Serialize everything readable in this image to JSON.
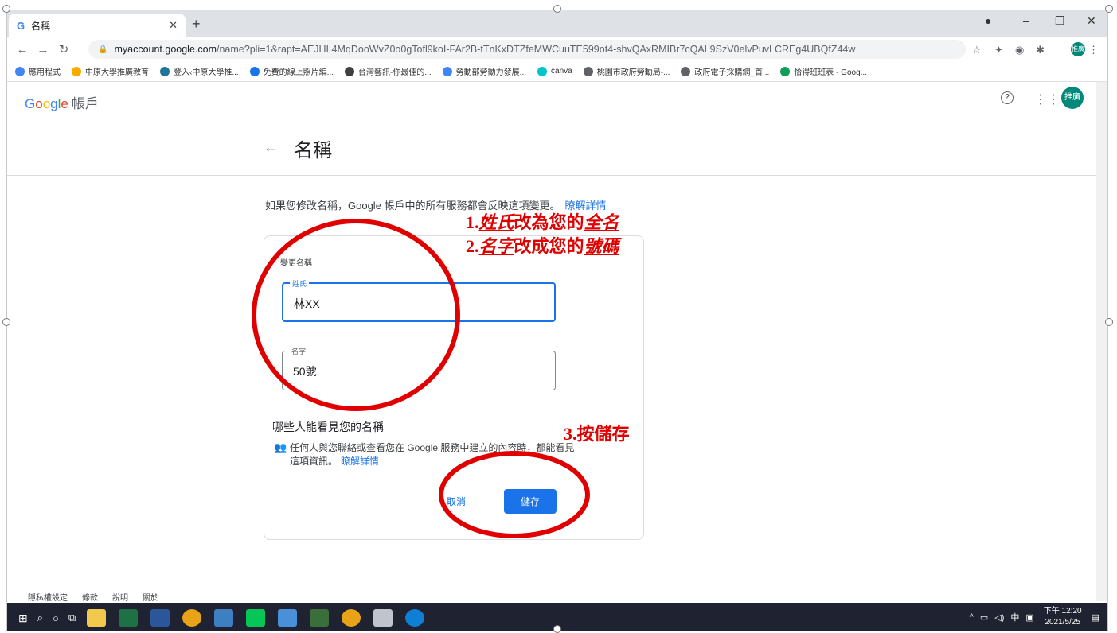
{
  "browser": {
    "tab_title": "名稱",
    "tab_icon": "G",
    "url_host": "myaccount.google.com",
    "url_path": "/name?pli=1&rapt=AEJHL4MqDooWvZ0o0gTofl9koI-FAr2B-tTnKxDTZfeMWCuuTE599ot4-shvQAxRMIBr7cQAL9SzV0elvPuvLCREg4UBQfZ44w",
    "profile_avatar": "推廣",
    "bookmarks": [
      {
        "label": "應用程式",
        "color": "#4285f4"
      },
      {
        "label": "中原大學推廣教育",
        "color": "#f9ab00"
      },
      {
        "label": "登入‹中原大學推...",
        "color": "#21759b"
      },
      {
        "label": "免費的線上照片編...",
        "color": "#1a73e8"
      },
      {
        "label": "台灣藝訊-你最佳的...",
        "color": "#3c4043"
      },
      {
        "label": "勞動部勞動力發展...",
        "color": "#4285f4"
      },
      {
        "label": "canva",
        "color": "#00c4cc"
      },
      {
        "label": "桃園市政府勞動局-...",
        "color": "#5f6368"
      },
      {
        "label": "政府電子採購網_首...",
        "color": "#5f6368"
      },
      {
        "label": "恰得班班表 - Goog...",
        "color": "#0f9d58"
      }
    ]
  },
  "header": {
    "product": "帳戶",
    "avatar": "推廣"
  },
  "page": {
    "title": "名稱",
    "description": "如果您修改名稱，Google 帳戶中的所有服務都會反映這項變更。",
    "learn_more": "瞭解詳情"
  },
  "card": {
    "heading": "變更名稱",
    "last_name_label": "姓氏",
    "last_name_value": "林XX",
    "first_name_label": "名字",
    "first_name_value": "50號",
    "visibility_title": "哪些人能看見您的名稱",
    "visibility_text": "任何人與您聯絡或查看您在 Google 服務中建立的內容時，都能看見這項資訊。",
    "visibility_link": "瞭解詳情",
    "cancel_label": "取消",
    "save_label": "儲存"
  },
  "annotations": {
    "line1_prefix": "1.",
    "line1_em1": "姓氏",
    "line1_mid": "改為您的",
    "line1_em2": "全名",
    "line2_prefix": "2.",
    "line2_em1": "名字",
    "line2_mid": "改成您的",
    "line2_em2": "號碼",
    "line3": "3.按儲存",
    "color": "#e00000"
  },
  "footer": [
    "隱私權設定",
    "條款",
    "說明",
    "關於"
  ],
  "taskbar": {
    "time": "下午 12:20",
    "date": "2021/5/25",
    "ime": "中"
  }
}
